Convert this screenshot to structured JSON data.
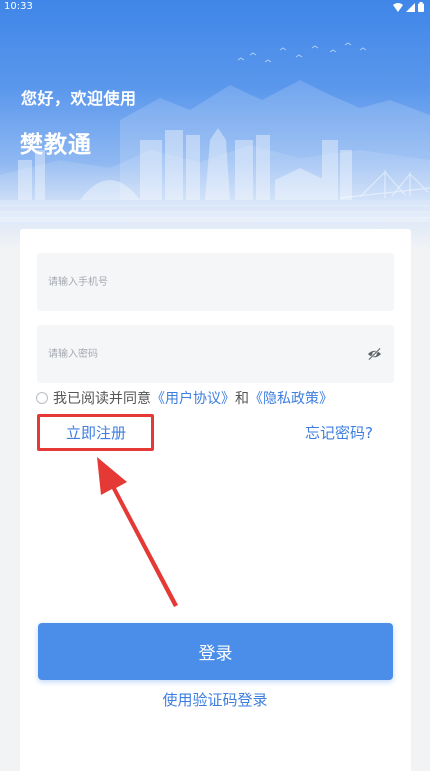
{
  "status_bar": {
    "time": "10:33"
  },
  "header": {
    "greeting": "您好，欢迎使用",
    "app_name": "樊教通"
  },
  "form": {
    "phone_placeholder": "请输入手机号",
    "phone_value": "",
    "password_placeholder": "请输入密码",
    "password_value": "",
    "agree_checked": false,
    "agree_text": "我已阅读并同意",
    "user_agreement": "《用户协议》",
    "and_text": "和",
    "privacy_policy": "《隐私政策》",
    "register_label": "立即注册",
    "forgot_label": "忘记密码?",
    "login_label": "登录",
    "sms_login_label": "使用验证码登录"
  },
  "colors": {
    "accent": "#4a8ee9",
    "link": "#3d7ee0",
    "highlight": "#e53935",
    "hero_top": "#3f86e8"
  },
  "icons": [
    "wifi-icon",
    "signal-icon",
    "battery-icon",
    "eye-off-icon",
    "annotation-arrow"
  ]
}
